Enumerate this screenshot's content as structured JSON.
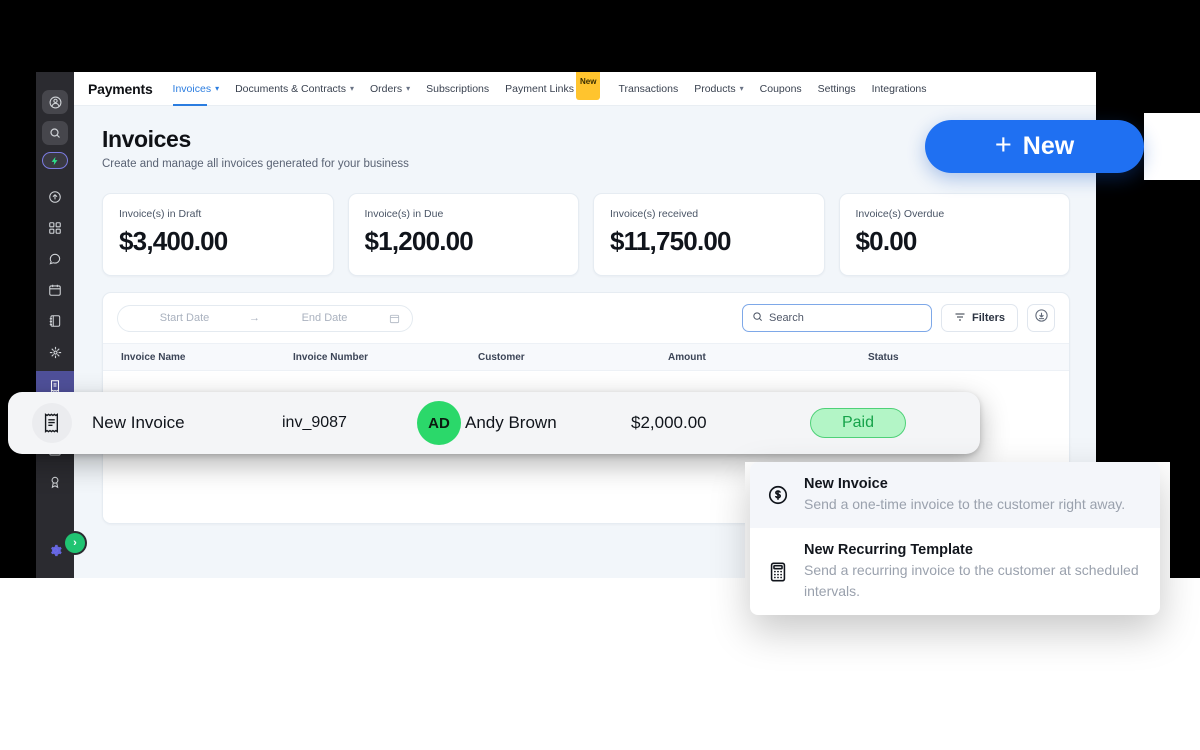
{
  "colors": {
    "accent": "#1f70f2",
    "nav_active": "#2b7de0",
    "badge_new": "#ffc42e",
    "avatar": "#2bd86a",
    "status_paid_bg": "#b3f5c6",
    "status_paid_text": "#16a34a",
    "rail_active": "#4f5099",
    "expand_chip": "#20c472"
  },
  "rail": {
    "items": [
      {
        "name": "account-avatar",
        "icon": "user-circle-icon"
      },
      {
        "name": "search",
        "icon": "search-icon"
      },
      {
        "name": "ai-assistant",
        "icon": "lightning-bolt-icon"
      },
      {
        "name": "updates",
        "icon": "arrow-up-circle-icon"
      },
      {
        "name": "apps",
        "icon": "grid-apps-icon"
      },
      {
        "name": "chat",
        "icon": "chat-bubble-icon"
      },
      {
        "name": "calendar",
        "icon": "calendar-icon"
      },
      {
        "name": "notes",
        "icon": "notebook-icon"
      },
      {
        "name": "automations",
        "icon": "nodes-icon"
      },
      {
        "name": "payments",
        "icon": "receipt-icon"
      },
      {
        "name": "marketing",
        "icon": "megaphone-icon"
      },
      {
        "name": "media",
        "icon": "image-card-icon"
      },
      {
        "name": "rewards",
        "icon": "award-ribbon-icon"
      },
      {
        "name": "settings",
        "icon": "gear-icon"
      }
    ],
    "expand_label": "›"
  },
  "topnav": {
    "brand": "Payments",
    "items": [
      {
        "label": "Invoices",
        "caret": true,
        "active": true,
        "badge": ""
      },
      {
        "label": "Documents & Contracts",
        "caret": true,
        "active": false,
        "badge": ""
      },
      {
        "label": "Orders",
        "caret": true,
        "active": false,
        "badge": ""
      },
      {
        "label": "Subscriptions",
        "caret": false,
        "active": false,
        "badge": ""
      },
      {
        "label": "Payment Links",
        "caret": false,
        "active": false,
        "badge": "New"
      },
      {
        "label": "Transactions",
        "caret": false,
        "active": false,
        "badge": ""
      },
      {
        "label": "Products",
        "caret": true,
        "active": false,
        "badge": ""
      },
      {
        "label": "Coupons",
        "caret": false,
        "active": false,
        "badge": ""
      },
      {
        "label": "Settings",
        "caret": false,
        "active": false,
        "badge": ""
      },
      {
        "label": "Integrations",
        "caret": false,
        "active": false,
        "badge": ""
      }
    ]
  },
  "page": {
    "title": "Invoices",
    "subtitle": "Create and manage all invoices generated for your business"
  },
  "new_button": {
    "plus": "+",
    "label": "New"
  },
  "stats": [
    {
      "label": "Invoice(s) in Draft",
      "value": "$3,400.00"
    },
    {
      "label": "Invoice(s) in Due",
      "value": "$1,200.00"
    },
    {
      "label": "Invoice(s) received",
      "value": "$11,750.00"
    },
    {
      "label": "Invoice(s) Overdue",
      "value": "$0.00"
    }
  ],
  "toolbar": {
    "start_date_placeholder": "Start Date",
    "range_arrow": "→",
    "end_date_placeholder": "End Date",
    "search_placeholder": "Search",
    "filters_label": "Filters",
    "download_icon": "download-circle-icon",
    "calendar_icon": "calendar-icon",
    "search_icon": "search-icon",
    "filter_icon": "filter-lines-icon"
  },
  "table": {
    "columns": [
      "Invoice Name",
      "Invoice Number",
      "Customer",
      "Amount",
      "Status"
    ],
    "rows": [
      {
        "icon": "receipt-icon",
        "name": "New Invoice",
        "number": "inv_9087",
        "customer_initials": "AD",
        "customer": "Andy Brown",
        "amount": "$2,000.00",
        "status": "Paid"
      }
    ]
  },
  "menu": {
    "items": [
      {
        "icon": "dollar-circle-icon",
        "title": "New Invoice",
        "desc": "Send a one-time invoice to the customer right away.",
        "highlighted": true
      },
      {
        "icon": "calculator-icon",
        "title": "New Recurring Template",
        "desc": "Send a recurring invoice to the customer at scheduled intervals.",
        "highlighted": false
      }
    ]
  }
}
